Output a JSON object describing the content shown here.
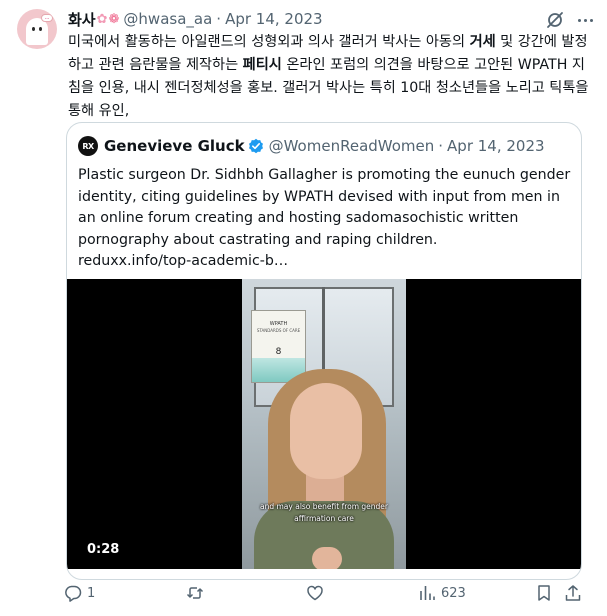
{
  "tweet": {
    "author_name": "화사",
    "author_emoji": [
      "✿",
      "❁"
    ],
    "handle": "@hwasa_aa",
    "separator": "·",
    "date": "Apr 14, 2023",
    "body_segments": [
      {
        "text": "미국에서 활동하는 아일랜드의 성형외과 의사 갤러거 박사는 아동의 ",
        "bold": false
      },
      {
        "text": "거세",
        "bold": true
      },
      {
        "text": " 및 강간에 발정하고 관련 음란물을 제작하는 ",
        "bold": false
      },
      {
        "text": "페티시",
        "bold": true
      },
      {
        "text": " 온라인 포럼의 의견을 바탕으로 고안된 WPATH 지침을 인용, 내시 젠더정체성을 홍보. 갤러거 박사는 특히 10대 청소년들을 노리고 틱톡을 통해 유인,",
        "bold": false
      }
    ]
  },
  "quote": {
    "avatar_text": "RX",
    "author_name": "Genevieve Gluck",
    "handle": "@WomenReadWomen",
    "separator": "·",
    "date": "Apr 14, 2023",
    "text": "Plastic surgeon Dr. Sidhbh Gallagher is promoting the eunuch gender identity, citing guidelines by WPATH devised with input from men in an online forum creating and hosting sadomasochistic written pornography about castrating and raping children.",
    "link": "reduxx.info/top-academic-b…",
    "video": {
      "book_title": "WPATH",
      "book_subtitle": "STANDARDS OF CARE",
      "book_number": "8",
      "caption": "and may also benefit from gender affirmation care",
      "duration": "0:28"
    }
  },
  "actions": {
    "reply_count": "1",
    "retweet_count": "",
    "like_count": "",
    "view_count": "623"
  },
  "colors": {
    "text": "#0f1419",
    "secondary": "#536471",
    "verified": "#1d9bf0",
    "border": "#cfd9de"
  }
}
